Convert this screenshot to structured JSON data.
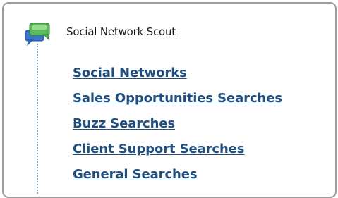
{
  "tree": {
    "root": {
      "icon": "chat-bubble-icon",
      "label": "Social Network Scout"
    },
    "items": [
      {
        "label": "Social Networks"
      },
      {
        "label": "Sales Opportunities Searches"
      },
      {
        "label": "Buzz Searches"
      },
      {
        "label": "Client Support Searches"
      },
      {
        "label": "General Searches"
      }
    ]
  },
  "colors": {
    "link": "#1f4e7f",
    "panel_border": "#9c9c9c",
    "tree_line": "#7fa3c4",
    "icon_green": "#5ab95a",
    "icon_blue": "#3b75c9"
  }
}
